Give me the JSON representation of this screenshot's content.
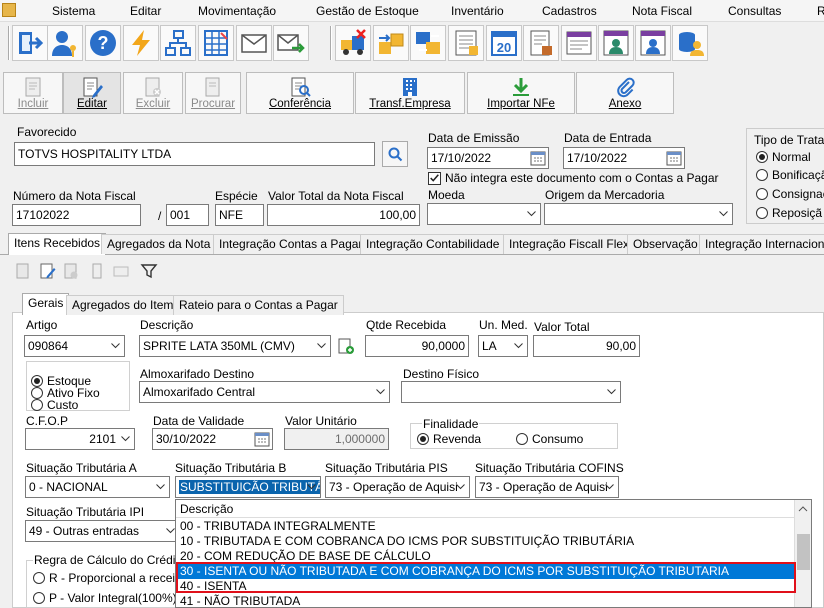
{
  "menu": {
    "items": [
      "Sistema",
      "Editar",
      "Movimentação",
      "Gestão de Estoque",
      "Inventário",
      "Cadastros",
      "Nota Fiscal",
      "Consultas",
      "R"
    ]
  },
  "actions": {
    "incluir": "Incluir",
    "editar": "Editar",
    "excluir": "Excluir",
    "procurar": "Procurar",
    "conferencia": "Conferência",
    "transf": "Transf.Empresa",
    "importar": "Importar NFe",
    "anexo": "Anexo"
  },
  "header": {
    "favorecido_label": "Favorecido",
    "favorecido_value": "TOTVS HOSPITALITY LTDA",
    "data_emissao_label": "Data de Emissão",
    "data_emissao_value": "17/10/2022",
    "data_entrada_label": "Data de Entrada",
    "data_entrada_value": "17/10/2022",
    "nao_integra_label": "Não integra este documento com o Contas a Pagar",
    "numero_nf_label": "Número da Nota Fiscal",
    "numero_nf_value": "17102022",
    "serie_value": "001",
    "especie_label": "Espécie",
    "especie_value": "NFE",
    "valor_total_nf_label": "Valor Total da Nota Fiscal",
    "valor_total_nf_value": "100,00",
    "moeda_label": "Moeda",
    "origem_label": "Origem da Mercadoria",
    "tipo_label": "Tipo de Tratar",
    "tipo_options": [
      "Normal",
      "Bonificaçã",
      "Consignaç",
      "Reposiçã"
    ]
  },
  "main_tabs": [
    "Itens Recebidos",
    "Agregados da Nota",
    "Integração Contas a Pagar",
    "Integração Contabilidade",
    "Integração Fiscall Flex",
    "Observação",
    "Integração Internaciona"
  ],
  "item_tabs": [
    "Gerais",
    "Agregados do Item",
    "Rateio para o Contas a Pagar"
  ],
  "item": {
    "artigo_label": "Artigo",
    "artigo_value": "090864",
    "descricao_label": "Descrição",
    "descricao_value": "SPRITE LATA 350ML (CMV)",
    "qtde_label": "Qtde Recebida",
    "qtde_value": "90,0000",
    "un_label": "Un. Med.",
    "un_value": "LA",
    "valor_total_label": "Valor Total",
    "valor_total_value": "90,00",
    "estoque_options": [
      "Estoque",
      "Ativo Fixo",
      "Custo"
    ],
    "almox_label": "Almoxarifado Destino",
    "almox_value": "Almoxarifado Central",
    "destino_label": "Destino Físico",
    "cfop_label": "C.F.O.P",
    "cfop_value": "2101",
    "validade_label": "Data de Validade",
    "validade_value": "30/10/2022",
    "valor_unit_label": "Valor Unitário",
    "valor_unit_value": "1,000000",
    "finalidade_label": "Finalidade",
    "revenda_label": "Revenda",
    "consumo_label": "Consumo",
    "sit_a_label": "Situação Tributária A",
    "sit_a_value": "0  -  NACIONAL",
    "sit_b_label": "Situação Tributária B",
    "sit_b_value": "SUBSTITUICÃO TRIBUTÁ",
    "sit_pis_label": "Situação Tributária PIS",
    "sit_pis_value": "73 - Operação de Aquisi",
    "sit_cofins_label": "Situação Tributária COFINS",
    "sit_cofins_value": "73 - Operação de Aquisi",
    "sit_ipi_label": "Situação Tributária IPI",
    "sit_ipi_value": "49 - Outras entradas",
    "regra_label": "Regra de Cálculo do Crédito",
    "regra_r": "R - Proporcional a receita",
    "regra_p": "P - Valor Integral(100%)"
  },
  "dropdown": {
    "header": "Descrição",
    "rows": [
      "00  -  TRIBUTADA INTEGRALMENTE",
      "10  -  TRIBUTADA E COM COBRANCA DO ICMS POR SUBSTITUIÇÃO TRIBUTÁRIA",
      "20  -  COM REDUÇÃO DE BASE DE CÁLCULO",
      "30  -  ISENTA OU NÃO TRIBUTADA E COM COBRANÇA DO ICMS POR SUBSTITUIÇÃO TRIBUTARIA",
      "40  -  ISENTA",
      "41  -  NÃO TRIBUTADA"
    ],
    "selected_index": 3
  },
  "colors": {
    "selection": "#0078d7",
    "highlight_box": "#e0101a"
  }
}
